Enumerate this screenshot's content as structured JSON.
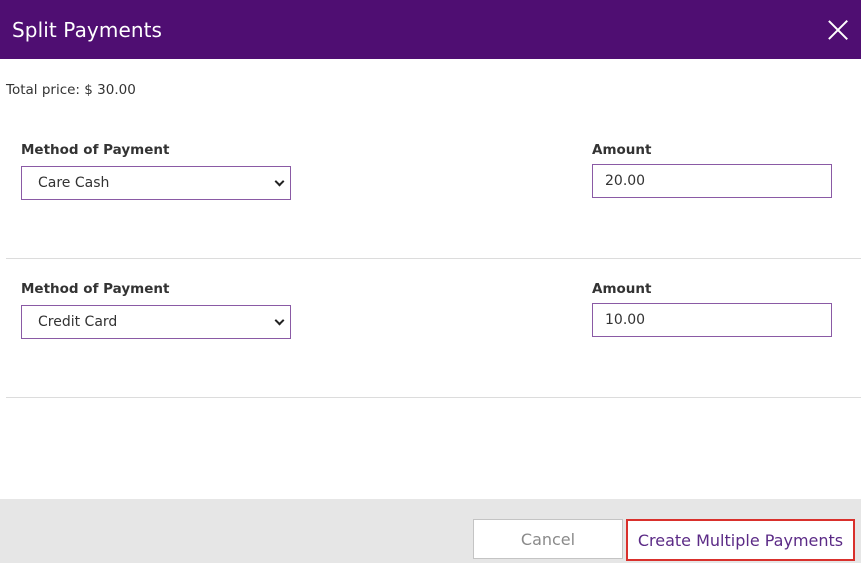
{
  "dialog": {
    "title": "Split Payments",
    "close_icon": "close-icon",
    "total_label": "Total price: $ 30.00"
  },
  "rows": [
    {
      "method_label": "Method of Payment",
      "method_value": "Care Cash",
      "amount_label": "Amount",
      "amount_value": "20.00"
    },
    {
      "method_label": "Method of Payment",
      "method_value": "Credit Card",
      "amount_label": "Amount",
      "amount_value": "10.00"
    }
  ],
  "footer": {
    "cancel_label": "Cancel",
    "create_label": "Create Multiple Payments"
  },
  "colors": {
    "header_bg": "#4f0e72",
    "accent_text": "#5b2a86",
    "highlight_border": "#d9302c"
  }
}
